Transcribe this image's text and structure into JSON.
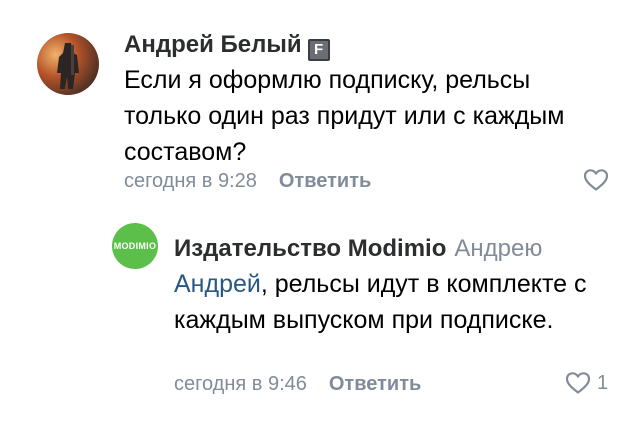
{
  "comments": [
    {
      "author": "Андрей Белый",
      "badge": "F",
      "text": "Если я оформлю подписку, рельсы только один раз придут или с каждым составом?",
      "time": "сегодня в 9:28",
      "reply_label": "Ответить",
      "likes": ""
    },
    {
      "author": "Издательство Modimio",
      "reply_to": "Андрею",
      "avatar_text": "MODIMIO",
      "mention": "Андрей",
      "text": ", рельсы идут в комплекте с каждым выпуском при подписке.",
      "time": "сегодня в 9:46",
      "reply_label": "Ответить",
      "likes": "1"
    }
  ],
  "colors": {
    "accent_link": "#2a5885",
    "secondary_text": "#818c99",
    "modimio_green": "#5bbf4a"
  },
  "icons": [
    "heart-outline-icon"
  ]
}
